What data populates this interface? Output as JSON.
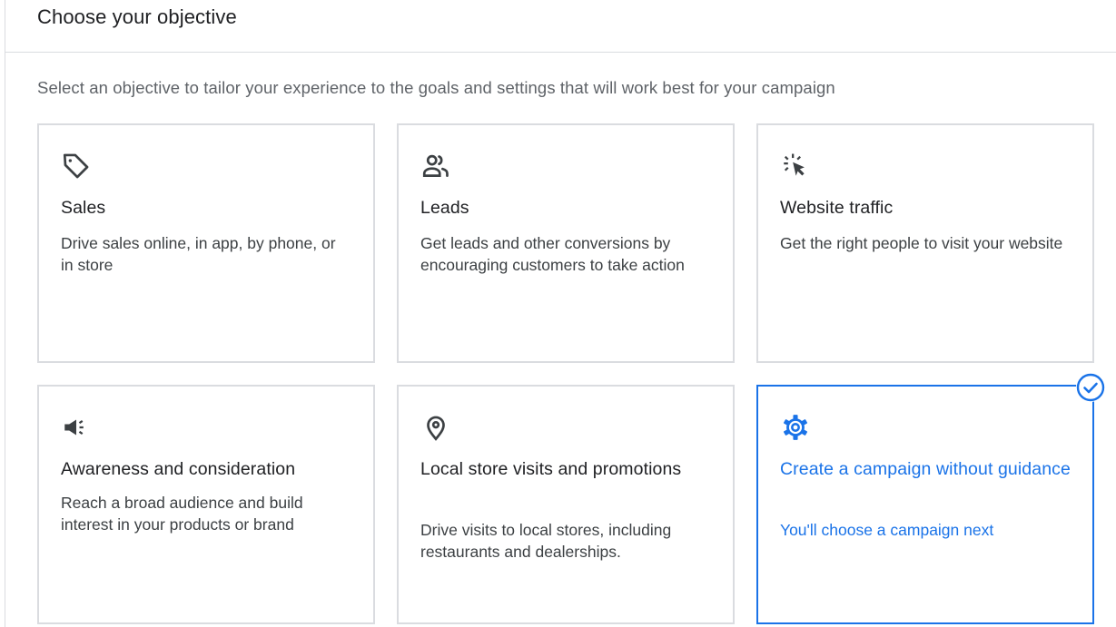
{
  "header": {
    "title": "Choose your objective"
  },
  "subtitle": "Select an objective to tailor your experience to the goals and settings that will work best for your campaign",
  "accent_color": "#1a73e8",
  "border_color": "#dadce0",
  "cards": [
    {
      "title": "Sales",
      "description": "Drive sales online, in app, by phone, or in store",
      "icon": "tag-icon",
      "selected": false
    },
    {
      "title": "Leads",
      "description": "Get leads and other conversions by encouraging customers to take action",
      "icon": "people-icon",
      "selected": false
    },
    {
      "title": "Website traffic",
      "description": "Get the right people to visit your website",
      "icon": "cursor-click-icon",
      "selected": false
    },
    {
      "title": "Awareness and consideration",
      "description": "Reach a broad audience and build interest in your products or brand",
      "icon": "megaphone-icon",
      "selected": false
    },
    {
      "title": "Local store visits and promotions",
      "description": "Drive visits to local stores, including restaurants and dealerships.",
      "icon": "location-pin-icon",
      "selected": false
    },
    {
      "title": "Create a campaign without guidance",
      "description": "You'll choose a campaign next",
      "icon": "gear-icon",
      "selected": true
    }
  ]
}
